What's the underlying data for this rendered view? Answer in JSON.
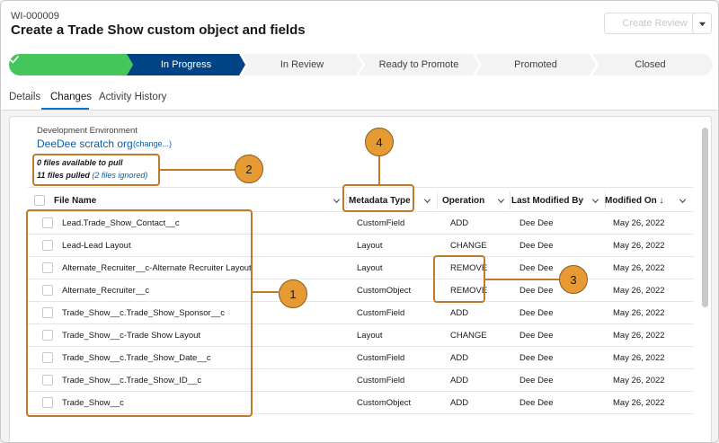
{
  "header": {
    "work_item_id": "WI-000009",
    "title": "Create a Trade Show custom object and fields",
    "create_review_label": "Create Review"
  },
  "path": {
    "stages": [
      {
        "label": "",
        "state": "complete"
      },
      {
        "label": "In Progress",
        "state": "current"
      },
      {
        "label": "In Review",
        "state": "incomplete"
      },
      {
        "label": "Ready to Promote",
        "state": "incomplete"
      },
      {
        "label": "Promoted",
        "state": "incomplete"
      },
      {
        "label": "Closed",
        "state": "incomplete"
      }
    ],
    "colors": {
      "complete": "#45c65a",
      "current": "#014486",
      "incomplete": "#f3f3f3"
    }
  },
  "tabs": [
    {
      "label": "Details",
      "active": false
    },
    {
      "label": "Changes",
      "active": true
    },
    {
      "label": "Activity History",
      "active": false
    }
  ],
  "environment": {
    "label": "Development Environment",
    "org_name": "DeeDee scratch org",
    "change_link": "(change...)",
    "files_available": "0 files available to pull",
    "files_pulled": "11 files pulled",
    "files_ignored": "(2 files ignored)"
  },
  "table": {
    "columns": [
      {
        "label": "File Name"
      },
      {
        "label": "Metadata Type"
      },
      {
        "label": "Operation"
      },
      {
        "label": "Last Modified By"
      },
      {
        "label": "Modified On ↓"
      }
    ],
    "rows": [
      {
        "file": "Lead.Trade_Show_Contact__c",
        "type": "CustomField",
        "op": "ADD",
        "by": "Dee Dee",
        "on": "May 26, 2022"
      },
      {
        "file": "Lead-Lead Layout",
        "type": "Layout",
        "op": "CHANGE",
        "by": "Dee Dee",
        "on": "May 26, 2022"
      },
      {
        "file": "Alternate_Recruiter__c-Alternate Recruiter Layout",
        "type": "Layout",
        "op": "REMOVE",
        "by": "Dee Dee",
        "on": "May 26, 2022"
      },
      {
        "file": "Alternate_Recruiter__c",
        "type": "CustomObject",
        "op": "REMOVE",
        "by": "Dee Dee",
        "on": "May 26, 2022"
      },
      {
        "file": "Trade_Show__c.Trade_Show_Sponsor__c",
        "type": "CustomField",
        "op": "ADD",
        "by": "Dee Dee",
        "on": "May 26, 2022"
      },
      {
        "file": "Trade_Show__c-Trade Show Layout",
        "type": "Layout",
        "op": "CHANGE",
        "by": "Dee Dee",
        "on": "May 26, 2022"
      },
      {
        "file": "Trade_Show__c.Trade_Show_Date__c",
        "type": "CustomField",
        "op": "ADD",
        "by": "Dee Dee",
        "on": "May 26, 2022"
      },
      {
        "file": "Trade_Show__c.Trade_Show_ID__c",
        "type": "CustomField",
        "op": "ADD",
        "by": "Dee Dee",
        "on": "May 26, 2022"
      },
      {
        "file": "Trade_Show__c",
        "type": "CustomObject",
        "op": "ADD",
        "by": "Dee Dee",
        "on": "May 26, 2022"
      }
    ]
  },
  "callouts": {
    "c1": "1",
    "c2": "2",
    "c3": "3",
    "c4": "4",
    "color": "#c1792b",
    "badge_color": "#e59a34"
  },
  "icons": {
    "check": "check-icon",
    "chevron": "chevron-down-icon",
    "menu": "caret-down-icon"
  }
}
